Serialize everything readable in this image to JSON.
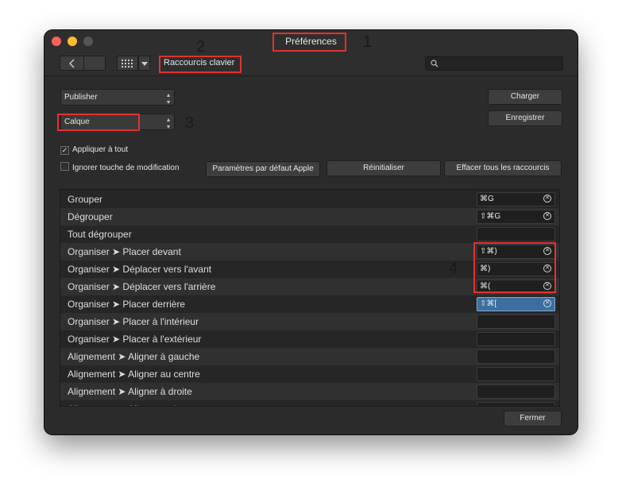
{
  "window": {
    "title": "Préférences"
  },
  "toolbar": {
    "back_icon": "chevron-left-icon",
    "forward_icon": "chevron-right-icon",
    "grid_icon": "grid-icon",
    "dropdown_icon": "chevron-down-icon",
    "breadcrumb": "Raccourcis clavier",
    "search_icon": "search-icon",
    "search_placeholder": ""
  },
  "controls": {
    "app_select": "Publisher",
    "category_select": "Calque",
    "apply_all_label": "Appliquer à tout",
    "apply_all_checked": true,
    "ignore_modifier_label": "Ignorer touche de modification",
    "ignore_modifier_checked": false,
    "apple_defaults_button": "Paramètres par défaut Apple",
    "reset_button": "Réinitialiser",
    "clear_all_button": "Effacer tous les raccourcis",
    "load_button": "Charger",
    "save_button": "Enregistrer",
    "close_button": "Fermer"
  },
  "shortcuts": [
    {
      "label": "Grouper",
      "shortcut": "⌘G"
    },
    {
      "label": "Dégrouper",
      "shortcut": "⇧⌘G"
    },
    {
      "label": "Tout dégrouper",
      "shortcut": ""
    },
    {
      "label": "Organiser ➤ Placer devant",
      "shortcut": "⇧⌘)"
    },
    {
      "label": "Organiser ➤ Déplacer vers l'avant",
      "shortcut": "⌘)"
    },
    {
      "label": "Organiser ➤ Déplacer vers l'arrière",
      "shortcut": "⌘("
    },
    {
      "label": "Organiser ➤ Placer derrière",
      "shortcut": "⇧⌘["
    },
    {
      "label": "Organiser ➤ Placer à l'intérieur",
      "shortcut": ""
    },
    {
      "label": "Organiser ➤ Placer à l'extérieur",
      "shortcut": ""
    },
    {
      "label": "Alignement ➤ Aligner à gauche",
      "shortcut": ""
    },
    {
      "label": "Alignement ➤ Aligner au centre",
      "shortcut": ""
    },
    {
      "label": "Alignement ➤ Aligner à droite",
      "shortcut": ""
    },
    {
      "label": "Alignement ➤ Aligner en haut",
      "shortcut": ""
    }
  ],
  "active_shortcut_index": 6,
  "annotations": [
    "1",
    "2",
    "3",
    "4"
  ],
  "colors": {
    "annotation_box": "#e0332f",
    "active_field": "#3c6fa0"
  }
}
